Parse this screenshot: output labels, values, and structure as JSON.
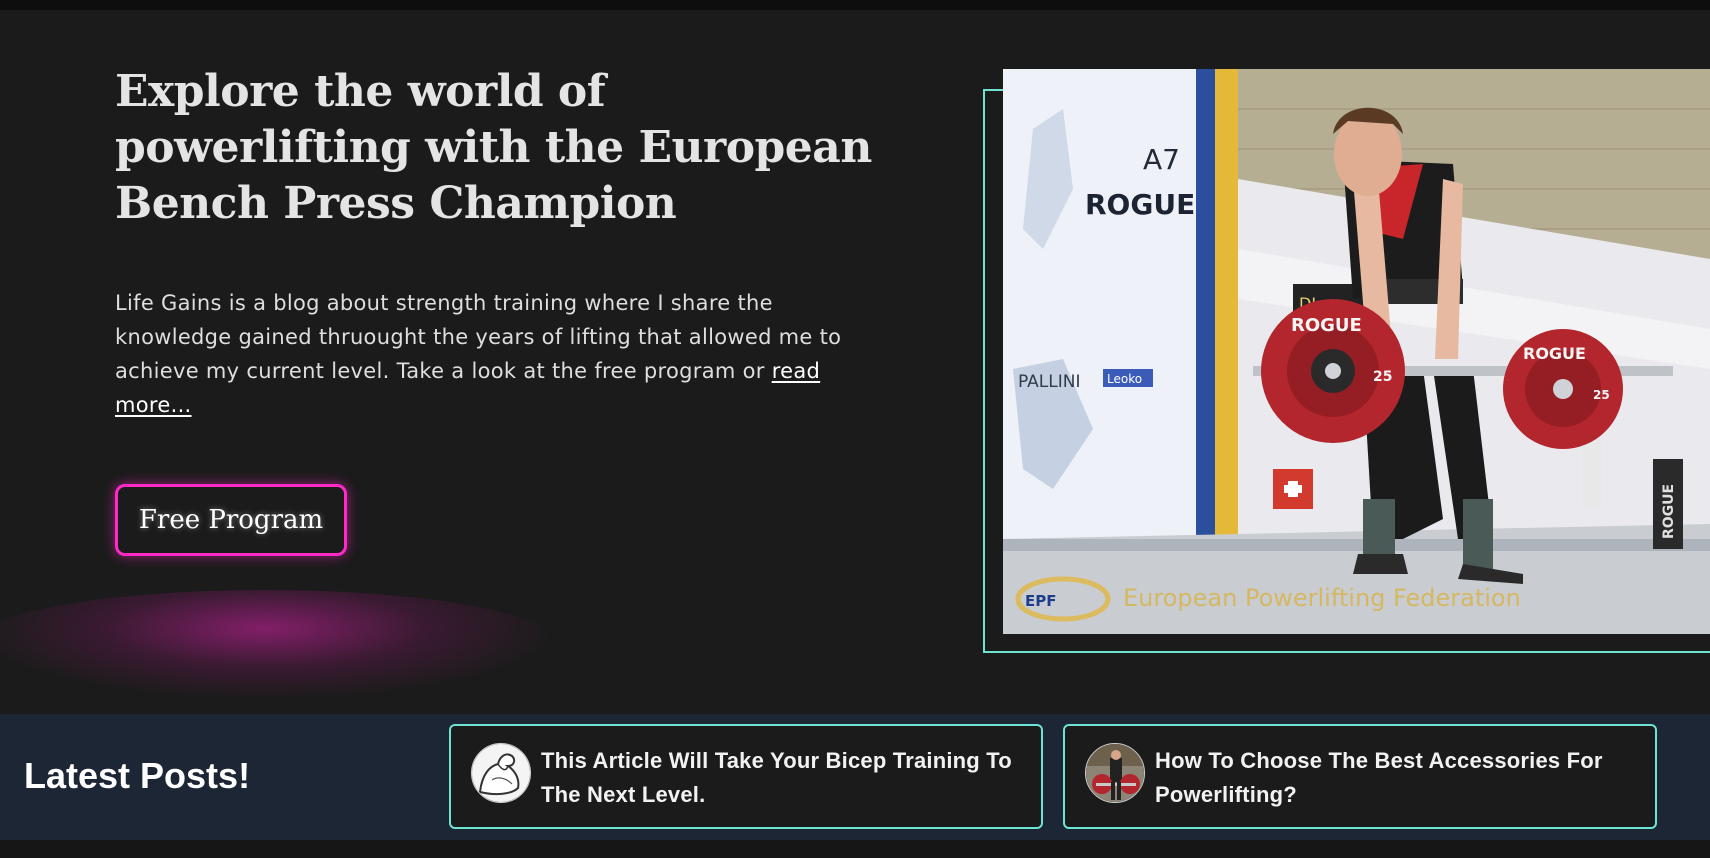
{
  "hero": {
    "title": "Explore the world of powerlifting with the European Bench Press Champion",
    "intro_text": "Life Gains is a blog about strength training where I share the knowledge gained thruought the years of lifting that allowed me to achieve my current level. Take a look at the free program or ",
    "read_more_label": "read more...",
    "cta_label": "Free Program",
    "image": {
      "icon": "powerlifter-deadlift-photo",
      "banner_brand_1": "A7",
      "banner_brand_2": "ROGUE",
      "banner_brand_3": "PALLINI",
      "banner_brand_4": "Leoko",
      "plate_brand": "ROGUE",
      "plate_weight": "25",
      "score_label": "DL",
      "floor_logo": "EPF",
      "floor_text": "European Powerlifting Federation",
      "stand_brand": "ROGUE"
    }
  },
  "latest_posts": {
    "heading": "Latest Posts!",
    "posts": [
      {
        "title": "This Article Will Take Your Bicep Training To The Next Level.",
        "icon": "flexed-bicep-icon"
      },
      {
        "title": "How To Choose The Best Accessories For Powerlifting?",
        "icon": "powerlifter-thumbnail-icon"
      }
    ]
  },
  "colors": {
    "background": "#1b1b1b",
    "accent_pink": "#ff2ac6",
    "accent_teal": "#6ee3d2",
    "band": "#1d2634"
  }
}
